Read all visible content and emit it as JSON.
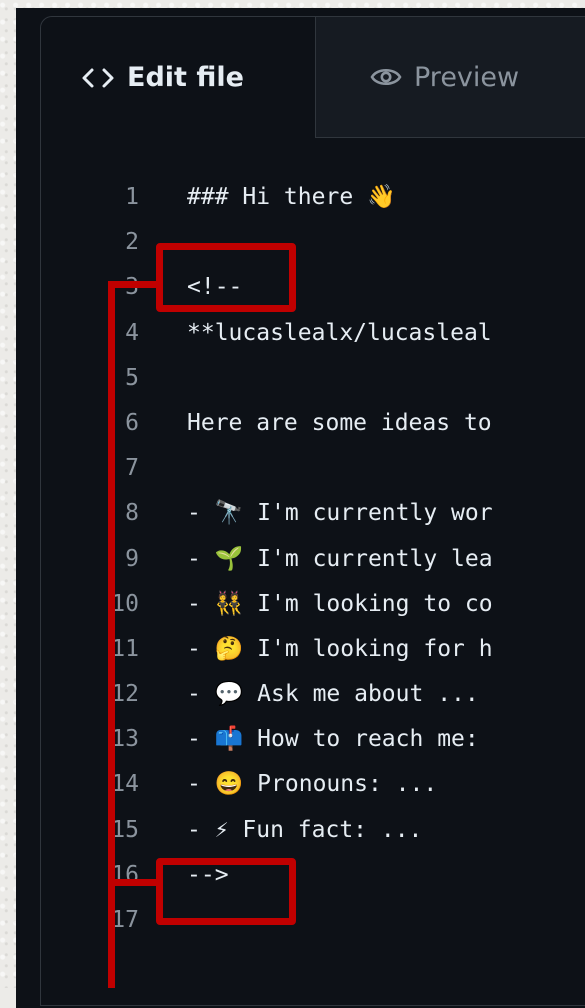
{
  "tabs": {
    "edit": {
      "icon": "code-icon",
      "label": "Edit file"
    },
    "preview": {
      "icon": "eye-icon",
      "label": "Preview"
    }
  },
  "lines": [
    {
      "num": "1",
      "text": "### Hi there 👋"
    },
    {
      "num": "2",
      "text": ""
    },
    {
      "num": "3",
      "text": "<!--"
    },
    {
      "num": "4",
      "text": "**lucaslealx/lucasleal"
    },
    {
      "num": "5",
      "text": ""
    },
    {
      "num": "6",
      "text": "Here are some ideas to"
    },
    {
      "num": "7",
      "text": ""
    },
    {
      "num": "8",
      "text": "- 🔭 I'm currently wor"
    },
    {
      "num": "9",
      "text": "- 🌱 I'm currently lea"
    },
    {
      "num": "10",
      "text": "- 👯 I'm looking to co"
    },
    {
      "num": "11",
      "text": "- 🤔 I'm looking for h"
    },
    {
      "num": "12",
      "text": "- 💬 Ask me about ..."
    },
    {
      "num": "13",
      "text": "- 📫 How to reach me:"
    },
    {
      "num": "14",
      "text": "- 😄 Pronouns: ..."
    },
    {
      "num": "15",
      "text": "- ⚡ Fun fact: ..."
    },
    {
      "num": "16",
      "text": "-->"
    },
    {
      "num": "17",
      "text": ""
    }
  ],
  "colors": {
    "annotation": "#c00000",
    "editor_bg": "#0d1117",
    "tab_bg": "#161b22"
  }
}
